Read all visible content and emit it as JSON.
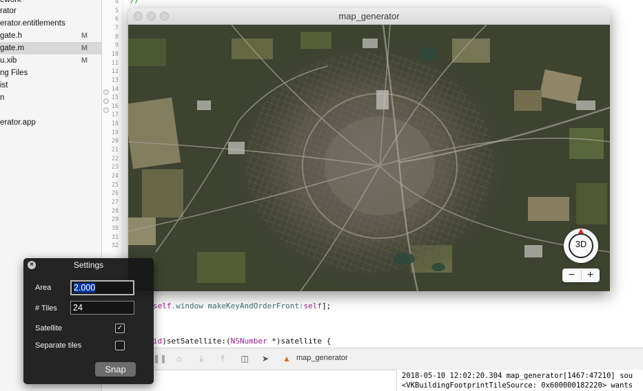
{
  "navigator": {
    "items": [
      {
        "label": "ework",
        "badge": ""
      },
      {
        "label": "rator",
        "badge": ""
      },
      {
        "label": "erator.entitlements",
        "badge": ""
      },
      {
        "label": "gate.h",
        "badge": "M"
      },
      {
        "label": "gate.m",
        "badge": "M"
      },
      {
        "label": "u.xib",
        "badge": "M"
      },
      {
        "label": "ng Files",
        "badge": ""
      },
      {
        "label": "ist",
        "badge": ""
      },
      {
        "label": "n",
        "badge": ""
      },
      {
        "label": "",
        "badge": ""
      },
      {
        "label": "erator.app",
        "badge": ""
      }
    ]
  },
  "gutter": {
    "line_numbers": [
      "4",
      "5",
      "6",
      "7",
      "8",
      "9",
      "10",
      "11",
      "12",
      "13",
      "14",
      "15",
      "16",
      "17",
      "18",
      "19",
      "20",
      "21",
      "22",
      "23",
      "24",
      "25",
      "26",
      "27",
      "28",
      "29",
      "30",
      "31",
      "32"
    ]
  },
  "editor": {
    "top_comment": "//",
    "line_front_self": "self",
    "line_front_window": ".window ",
    "line_front_method": "makeKeyAndOrderFront:",
    "line_front_self2": "self",
    "line_front_end": "];",
    "line_sat_void": "id",
    "line_sat_paren": ")setSatellite:(",
    "line_sat_type": "NSNumber",
    "line_sat_rest": " *)satellite {"
  },
  "debug_bar": {
    "target_label": "map_generator"
  },
  "console": {
    "lines": [
      "2018-05-10 12:02:20.304 map_generator[1467:47210] sou",
      "<VKBuildingFootprintTileSource: 0x600000182220> wants"
    ]
  },
  "map_window": {
    "title": "map_generator",
    "compass_label": "3D",
    "zoom_out": "−",
    "zoom_in": "+"
  },
  "settings": {
    "title": "Settings",
    "area_label": "Area",
    "area_value": "2.000",
    "tiles_label": "# Tiles",
    "tiles_value": "24",
    "satellite_label": "Satellite",
    "satellite_checked": true,
    "separate_label": "Separate tiles",
    "separate_checked": false,
    "snap_label": "Snap"
  },
  "colors": {
    "hud_bg": "#161616",
    "keyword": "#a01d91",
    "compass_north": "#e0281c"
  }
}
